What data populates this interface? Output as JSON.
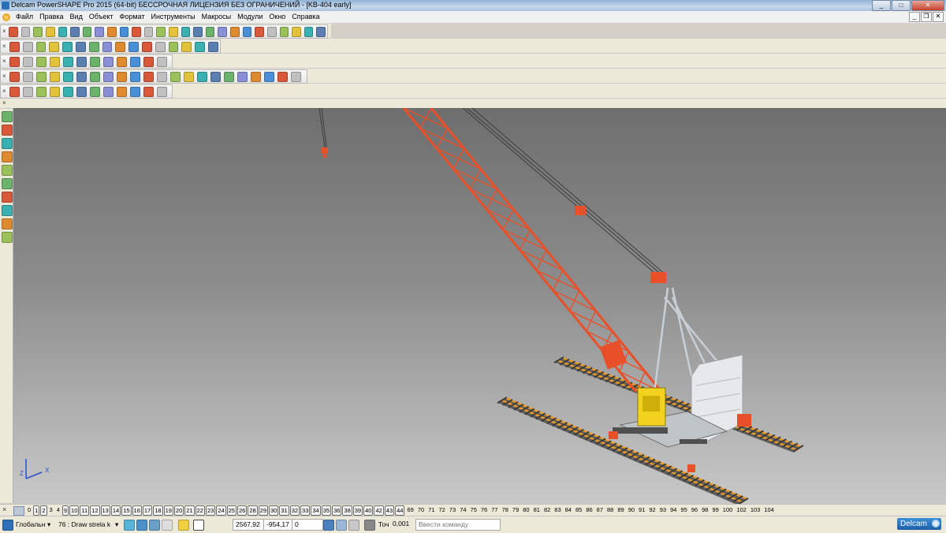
{
  "window": {
    "title": "Delcam PowerSHAPE Pro 2015 (64-bit) БЕССРОЧНАЯ ЛИЦЕНЗИЯ БЕЗ ОГРАНИЧЕНИЙ - [KB-404 early]",
    "minimize_icon": "minimize-icon",
    "maximize_icon": "maximize-icon",
    "close_icon": "close-icon"
  },
  "menu": {
    "items": [
      "Файл",
      "Правка",
      "Вид",
      "Объект",
      "Формат",
      "Инструменты",
      "Макросы",
      "Модули",
      "Окно",
      "Справка"
    ]
  },
  "viewport": {
    "axis_label_z": "Z",
    "axis_label_x": "X",
    "boom_color": "#e8502a",
    "rail_color": "#e79a2a",
    "cab_color": "#f2d21e"
  },
  "levels": {
    "items": [
      {
        "label": "0",
        "on": false
      },
      {
        "label": "1",
        "on": true
      },
      {
        "label": "2",
        "on": true
      },
      {
        "label": "3",
        "on": false
      },
      {
        "label": "4",
        "on": false
      },
      {
        "label": "9",
        "on": true
      },
      {
        "label": "10",
        "on": true
      },
      {
        "label": "11",
        "on": true
      },
      {
        "label": "12",
        "on": true
      },
      {
        "label": "13",
        "on": true
      },
      {
        "label": "14",
        "on": true
      },
      {
        "label": "15",
        "on": true
      },
      {
        "label": "16",
        "on": true
      },
      {
        "label": "17",
        "on": true
      },
      {
        "label": "18",
        "on": true
      },
      {
        "label": "19",
        "on": true
      },
      {
        "label": "20",
        "on": true
      },
      {
        "label": "21",
        "on": true
      },
      {
        "label": "22",
        "on": true
      },
      {
        "label": "23",
        "on": true
      },
      {
        "label": "24",
        "on": true
      },
      {
        "label": "25",
        "on": true
      },
      {
        "label": "26",
        "on": true
      },
      {
        "label": "28",
        "on": true
      },
      {
        "label": "29",
        "on": true
      },
      {
        "label": "30",
        "on": true
      },
      {
        "label": "31",
        "on": true
      },
      {
        "label": "32",
        "on": true
      },
      {
        "label": "33",
        "on": true
      },
      {
        "label": "34",
        "on": true
      },
      {
        "label": "35",
        "on": true
      },
      {
        "label": "36",
        "on": true
      },
      {
        "label": "38",
        "on": true
      },
      {
        "label": "39",
        "on": true
      },
      {
        "label": "40",
        "on": true
      },
      {
        "label": "42",
        "on": true
      },
      {
        "label": "43",
        "on": true
      },
      {
        "label": "44",
        "on": true
      },
      {
        "label": "69",
        "on": false
      },
      {
        "label": "70",
        "on": false
      },
      {
        "label": "71",
        "on": false
      },
      {
        "label": "72",
        "on": false
      },
      {
        "label": "73",
        "on": false
      },
      {
        "label": "74",
        "on": false
      },
      {
        "label": "75",
        "on": false
      },
      {
        "label": "76",
        "on": false
      },
      {
        "label": "77",
        "on": false
      },
      {
        "label": "78",
        "on": false
      },
      {
        "label": "79",
        "on": false
      },
      {
        "label": "80",
        "on": false
      },
      {
        "label": "81",
        "on": false
      },
      {
        "label": "82",
        "on": false
      },
      {
        "label": "83",
        "on": false
      },
      {
        "label": "84",
        "on": false
      },
      {
        "label": "85",
        "on": false
      },
      {
        "label": "86",
        "on": false
      },
      {
        "label": "87",
        "on": false
      },
      {
        "label": "88",
        "on": false
      },
      {
        "label": "89",
        "on": false
      },
      {
        "label": "90",
        "on": false
      },
      {
        "label": "91",
        "on": false
      },
      {
        "label": "92",
        "on": false
      },
      {
        "label": "93",
        "on": false
      },
      {
        "label": "94",
        "on": false
      },
      {
        "label": "95",
        "on": false
      },
      {
        "label": "96",
        "on": false
      },
      {
        "label": "98",
        "on": false
      },
      {
        "label": "99",
        "on": false
      },
      {
        "label": "100",
        "on": false
      },
      {
        "label": "102",
        "on": false
      },
      {
        "label": "103",
        "on": false
      },
      {
        "label": "104",
        "on": false
      }
    ]
  },
  "status": {
    "workplane": "Глобальн",
    "level_field": "76 : Draw strela k",
    "coord_x": "2567,92",
    "coord_y": "-954,17",
    "coord_z": "0",
    "tolerance_label": "Точ",
    "tolerance_value": "0,001",
    "command_placeholder": "Ввести команду",
    "brand": "Delcam"
  }
}
